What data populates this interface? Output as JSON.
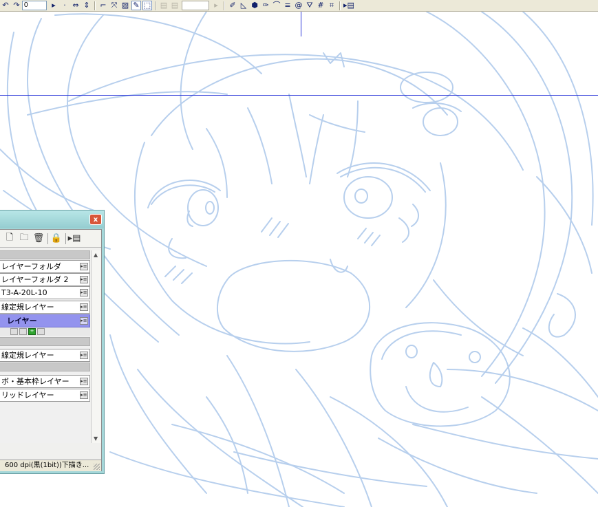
{
  "toolbar": {
    "number_value": "0",
    "tools": [
      {
        "name": "undo-icon",
        "glyph": "↶"
      },
      {
        "name": "redo-icon",
        "glyph": "↷"
      },
      {
        "name": "play-right-icon",
        "glyph": "▸"
      },
      {
        "name": "dot-icon",
        "glyph": "·"
      },
      {
        "name": "flip-horizontal-icon",
        "glyph": "⇔"
      },
      {
        "name": "flip-vertical-icon",
        "glyph": "⇕"
      },
      {
        "name": "rule-icon",
        "glyph": "⌐"
      },
      {
        "name": "transform-icon",
        "glyph": "⤧"
      },
      {
        "name": "image-icon",
        "glyph": "▨"
      },
      {
        "name": "selection-pen-icon",
        "glyph": "✎"
      },
      {
        "name": "marquee-icon",
        "glyph": "⬚"
      },
      {
        "name": "page-disabled-icon",
        "glyph": "▤"
      },
      {
        "name": "page2-disabled-icon",
        "glyph": "▤"
      },
      {
        "name": "pen-icon",
        "glyph": "✐"
      },
      {
        "name": "triangle-ruler-icon",
        "glyph": "◺"
      },
      {
        "name": "fill-icon",
        "glyph": "⬢"
      },
      {
        "name": "eyedropper-icon",
        "glyph": "✑"
      },
      {
        "name": "curve-icon",
        "glyph": "⌒"
      },
      {
        "name": "lines-icon",
        "glyph": "≡"
      },
      {
        "name": "spiral-icon",
        "glyph": "@"
      },
      {
        "name": "perspective-icon",
        "glyph": "⛛"
      },
      {
        "name": "grid-icon",
        "glyph": "#"
      },
      {
        "name": "grid2-icon",
        "glyph": "⌗"
      },
      {
        "name": "panel-menu-icon",
        "glyph": "▸▤"
      }
    ]
  },
  "palette": {
    "close_label": "x",
    "tools": [
      {
        "name": "new-layer-icon",
        "glyph": "🗋"
      },
      {
        "name": "new-folder-icon",
        "glyph": "🗀"
      },
      {
        "name": "trash-icon",
        "glyph": "🗑"
      },
      {
        "name": "lock-icon",
        "glyph": "🔒"
      },
      {
        "name": "palette-menu-icon",
        "glyph": "▸▤"
      }
    ],
    "layers": [
      {
        "name": "レイヤーフォルダ",
        "active": false
      },
      {
        "name": "レイヤーフォルダ 2",
        "active": false
      },
      {
        "name": "T3-A-20L-10",
        "active": false
      },
      {
        "name": "線定規レイヤー",
        "active": false
      },
      {
        "name": "レイヤー",
        "active": true
      },
      {
        "name": "線定規レイヤー",
        "active": false
      },
      {
        "name": "ボ・基本枠レイヤー",
        "active": false
      },
      {
        "name": "リッドレイヤー",
        "active": false
      }
    ],
    "status": "600 dpi(黒(1bit))下描き..."
  },
  "colors": {
    "sketch_line": "#b7cfed",
    "guide_line": "#2a36d8",
    "active_layer": "#9393ee",
    "palette_frame": "#a4d7d9"
  }
}
